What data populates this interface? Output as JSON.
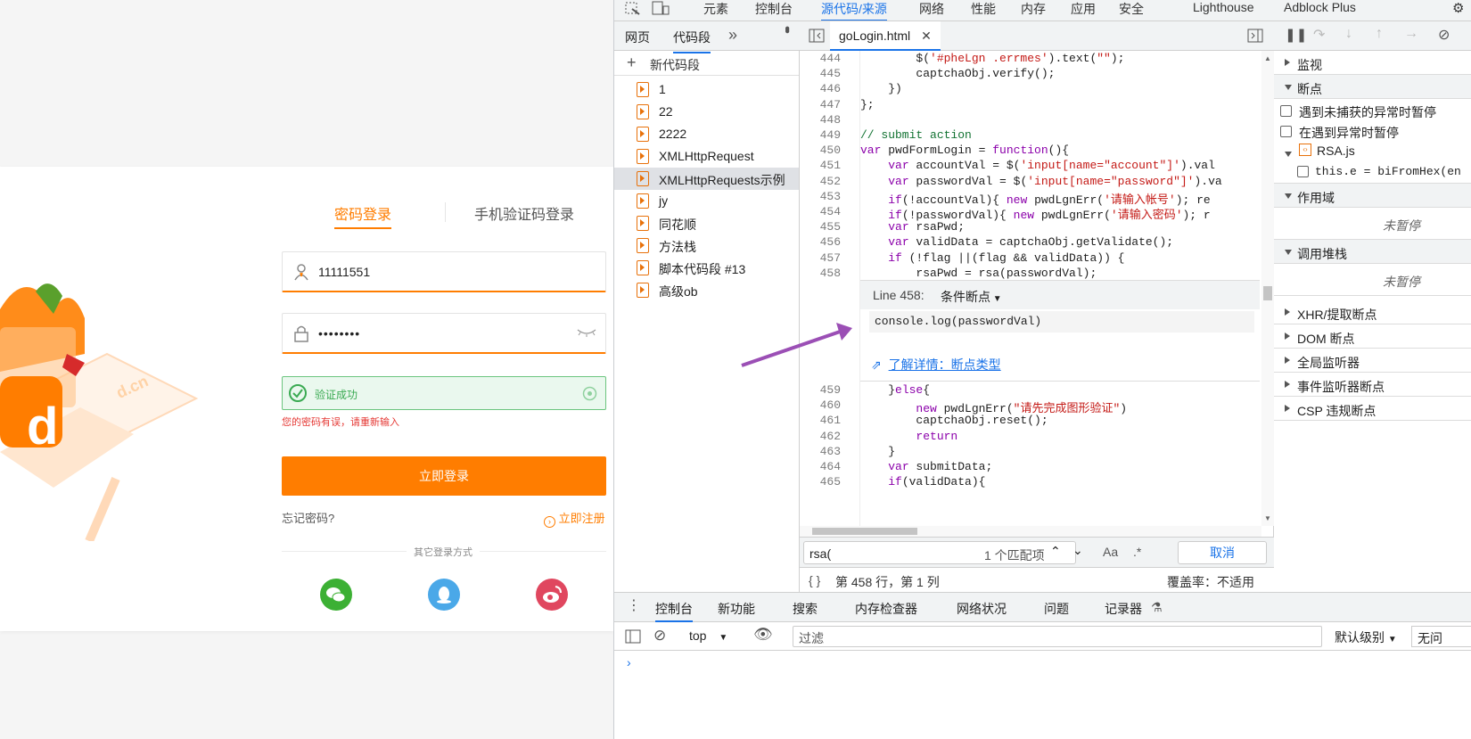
{
  "login": {
    "tab_password": "密码登录",
    "tab_sms": "手机验证码登录",
    "account_value": "11111551",
    "password_value": "••••••••",
    "verify_text": "验证成功",
    "error_text": "您的密码有误，请重新输入",
    "login_button": "立即登录",
    "forgot": "忘记密码?",
    "register": "立即注册",
    "other_methods": "其它登录方式",
    "brand_text": "d.cn",
    "logo_letter": "d"
  },
  "devtools": {
    "top_tabs": [
      "元素",
      "控制台",
      "源代码/来源",
      "网络",
      "性能",
      "内存",
      "应用",
      "安全",
      "Lighthouse",
      "Adblock Plus"
    ],
    "left_tabs": {
      "page": "网页",
      "snippets": "代码段",
      "more": "»"
    },
    "new_snippet": "新代码段",
    "snippets": [
      "1",
      "22",
      "2222",
      "XMLHttpRequest",
      "XMLHttpRequests示例",
      "jy",
      "同花顺",
      "方法栈",
      "脚本代码段 #13",
      "高级ob"
    ],
    "editor_tab": "goLogin.html",
    "code_lines_top": [
      {
        "n": "444",
        "t": "        $('#pheLgn .errmes').text(\"\");"
      },
      {
        "n": "445",
        "t": "        captchaObj.verify();"
      },
      {
        "n": "446",
        "t": "    })"
      },
      {
        "n": "447",
        "t": "};"
      },
      {
        "n": "448",
        "t": ""
      },
      {
        "n": "449",
        "t": "// submit action"
      },
      {
        "n": "450",
        "t": "var pwdFormLogin = function(){"
      },
      {
        "n": "451",
        "t": "    var accountVal = $('input[name=\"account\"]').val"
      },
      {
        "n": "452",
        "t": "    var passwordVal = $('input[name=\"password\"]').va"
      },
      {
        "n": "453",
        "t": "    if(!accountVal){ new pwdLgnErr('请输入帐号'); re"
      },
      {
        "n": "454",
        "t": "    if(!passwordVal){ new pwdLgnErr('请输入密码'); r"
      },
      {
        "n": "455",
        "t": "    var rsaPwd;"
      },
      {
        "n": "456",
        "t": "    var validData = captchaObj.getValidate();"
      },
      {
        "n": "457",
        "t": "    if (!flag ||(flag && validData)) {"
      },
      {
        "n": "458",
        "t": "        rsaPwd = rsa(passwordVal);"
      }
    ],
    "breakpoint": {
      "line_label": "Line 458:",
      "type": "条件断点",
      "condition": "console.log(passwordVal)",
      "learn_more": "了解详情：断点类型"
    },
    "code_lines_bottom": [
      {
        "n": "459",
        "t": "    }else{"
      },
      {
        "n": "460",
        "t": "        new pwdLgnErr(\"请先完成图形验证\")"
      },
      {
        "n": "461",
        "t": "        captchaObj.reset();"
      },
      {
        "n": "462",
        "t": "        return"
      },
      {
        "n": "463",
        "t": "    }"
      },
      {
        "n": "464",
        "t": "    var submitData;"
      },
      {
        "n": "465",
        "t": "    if(validData){"
      }
    ],
    "search": {
      "value": "rsa(",
      "matches": "1 个匹配项",
      "case": "Aa",
      "regex": ".*",
      "cancel": "取消"
    },
    "status": {
      "braces": "{ }",
      "position": "第 458 行，第 1 列",
      "coverage": "覆盖率：不适用"
    },
    "right": {
      "watch": "监视",
      "breakpoints": "断点",
      "pause_uncaught": "遇到未捕获的异常时暂停",
      "pause_caught": "在遇到异常时暂停",
      "file": "RSA.js",
      "bp_code": "this.e = biFromHex(en",
      "scope": "作用域",
      "not_paused_1": "未暂停",
      "call_stack": "调用堆栈",
      "not_paused_2": "未暂停",
      "xhr": "XHR/提取断点",
      "dom": "DOM 断点",
      "global": "全局监听器",
      "event": "事件监听器断点",
      "csp": "CSP 违规断点"
    },
    "console": {
      "tabs": [
        "控制台",
        "新功能",
        "搜索",
        "内存检查器",
        "网络状况",
        "问题",
        "记录器"
      ],
      "context": "top",
      "filter_placeholder": "过滤",
      "level": "默认级别",
      "no_issues": "无问"
    }
  },
  "colors": {
    "accent": "#ff7d00",
    "devtools_blue": "#1a73e8",
    "arrow": "#9b4fb5",
    "wechat": "#3cb034",
    "qq": "#4aa8e8",
    "weibo": "#e0475f"
  }
}
